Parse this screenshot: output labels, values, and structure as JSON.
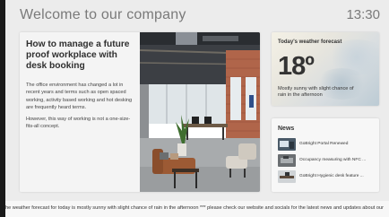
{
  "header": {
    "title": "Welcome to our company",
    "time": "13:30"
  },
  "article": {
    "title": "How to manage a future proof workplace with desk booking",
    "paragraphs": [
      "The office environment has changed a lot in recent years and terms such as open spaced working, activity based working and hot desking are frequently heard terms.",
      "However, this way of working is not a one-size-fits-all concept."
    ]
  },
  "weather": {
    "title": "Today's weather forecast",
    "temperature": "18º",
    "description": "Mostly sunny with slight chance of rain in the afternoon"
  },
  "news": {
    "title": "News",
    "items": [
      {
        "text": "GoBright Portal Renewed"
      },
      {
        "text": "Occupancy measuring with NFC ..."
      },
      {
        "text": "GoBright Hygienic desk feature ..."
      }
    ]
  },
  "ticker": {
    "text": "he weather forecast for today is mostly sunny with slight chance of rain in the afternoon *** please check our website and socials for the latest news and updates about our"
  }
}
